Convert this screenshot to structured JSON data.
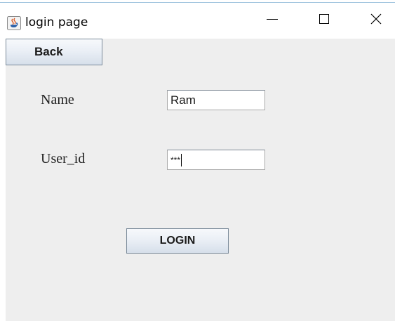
{
  "window": {
    "title": "login page",
    "app_icon": "java-coffee-icon",
    "controls": {
      "minimize_icon": "minimize-icon",
      "maximize_icon": "maximize-icon",
      "close_icon": "close-icon"
    }
  },
  "toolbar": {
    "back_label": "Back"
  },
  "form": {
    "name_label": "Name",
    "name_value": "Ram",
    "userid_label": "User_id",
    "userid_value": "***",
    "login_label": "LOGIN"
  },
  "colors": {
    "content_background": "#eeeeee",
    "button_gradient_top": "#f7f9fc",
    "button_gradient_bottom": "#d6dfea",
    "button_border": "#7a8a99"
  }
}
